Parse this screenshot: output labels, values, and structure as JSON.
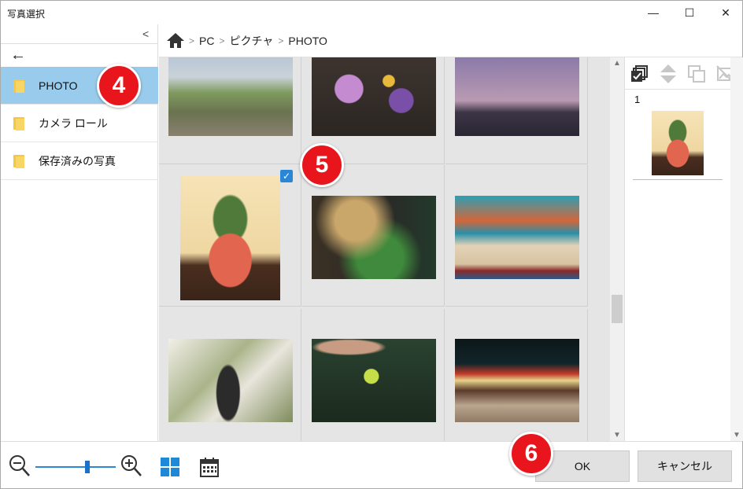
{
  "window": {
    "title": "写真選択"
  },
  "titlebar": {
    "minimize": "—",
    "maximize": "☐",
    "close": "✕"
  },
  "sidebar": {
    "collapse_glyph": "<",
    "back_glyph": "←",
    "items": [
      {
        "label": "PHOTO",
        "selected": true
      },
      {
        "label": "カメラ ロール",
        "selected": false
      },
      {
        "label": "保存済みの写真",
        "selected": false
      }
    ]
  },
  "breadcrumb": {
    "separator": ">",
    "items": [
      "PC",
      "ピクチャ",
      "PHOTO"
    ]
  },
  "grid": {
    "photos": [
      {
        "subject": "field-with-people",
        "colors": [
          "#9aa77c",
          "#6d6a55"
        ]
      },
      {
        "subject": "wildflowers",
        "colors": [
          "#3a3330",
          "#8e5aa3"
        ]
      },
      {
        "subject": "tower-dusk",
        "colors": [
          "#8a78a8",
          "#3b3345"
        ]
      },
      {
        "subject": "pineapple",
        "colors": [
          "#f3dcae",
          "#e0654f"
        ],
        "checked": true
      },
      {
        "subject": "gallery-plants",
        "colors": [
          "#2d2a22",
          "#3f7d3a"
        ]
      },
      {
        "subject": "dog-blanket",
        "colors": [
          "#2a9bb0",
          "#d96a3a"
        ]
      },
      {
        "subject": "palm-statue",
        "colors": [
          "#e9e6dd",
          "#7d8d5a"
        ]
      },
      {
        "subject": "hand-grapes",
        "colors": [
          "#203822",
          "#b8d44a"
        ]
      },
      {
        "subject": "night-stalls",
        "colors": [
          "#0e1a1a",
          "#c43a2a"
        ]
      }
    ]
  },
  "right_panel": {
    "selected_count": "1",
    "thumb_subject": "pineapple"
  },
  "bottom": {
    "zoom_level": 0.62,
    "ok_label": "OK",
    "cancel_label": "キャンセル"
  },
  "callouts": [
    "4",
    "5",
    "6"
  ],
  "colors": {
    "accent": "#2a87d8",
    "selected_row": "#99cbec",
    "folder": "#f5c642",
    "badge": "#e8151d"
  }
}
